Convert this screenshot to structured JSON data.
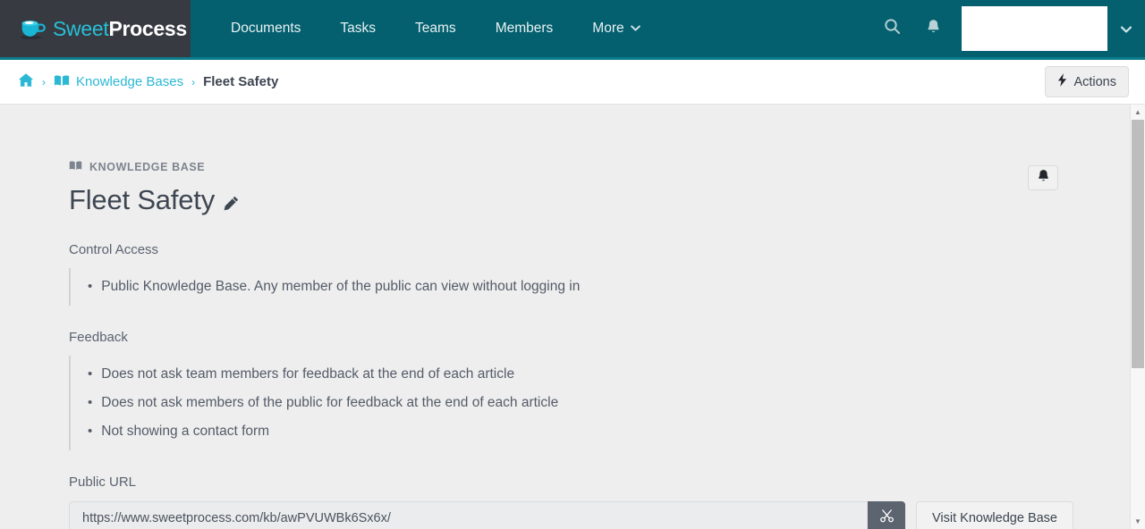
{
  "nav": {
    "logo": {
      "sweet": "Sweet",
      "process": "Process",
      "icon": "coffee-cup-icon"
    },
    "items": [
      {
        "label": "Documents",
        "caret": ""
      },
      {
        "label": "Tasks",
        "caret": ""
      },
      {
        "label": "Teams",
        "caret": ""
      },
      {
        "label": "Members",
        "caret": ""
      },
      {
        "label": "More",
        "caret": "⌄"
      }
    ],
    "search_icon": "search-icon",
    "bell_icon": "notification-bell-icon",
    "user_caret": "⌄",
    "colors": {
      "bar": "#04606e",
      "logo_panel": "#373a40",
      "accent": "#27c0d8"
    }
  },
  "breadcrumb": {
    "home_icon": "home-icon",
    "separator": "›",
    "kb_icon": "book-icon",
    "kb_label": "Knowledge Bases",
    "current": "Fleet Safety",
    "actions_label": "Actions",
    "actions_icon": "lightning-bolt-icon"
  },
  "page": {
    "eyebrow": "KNOWLEDGE BASE",
    "eyebrow_icon": "book-icon",
    "title": "Fleet Safety",
    "edit_icon": "pencil-icon",
    "subscribe_icon": "bell-icon"
  },
  "control_access": {
    "label": "Control Access",
    "items": [
      "Public Knowledge Base. Any member of the public can view without logging in"
    ]
  },
  "feedback": {
    "label": "Feedback",
    "items": [
      "Does not ask team members for feedback at the end of each article",
      "Does not ask members of the public for feedback at the end of each article",
      "Not showing a contact form"
    ]
  },
  "public_url": {
    "label": "Public URL",
    "value": "https://www.sweetprocess.com/kb/awPVUWBk6Sx6x/",
    "placeholder": "https://",
    "copy_icon": "scissors-cut-icon",
    "visit_label": "Visit Knowledge Base"
  },
  "scrollbar": {
    "up_arrow": "▲",
    "down_arrow": "▼"
  }
}
